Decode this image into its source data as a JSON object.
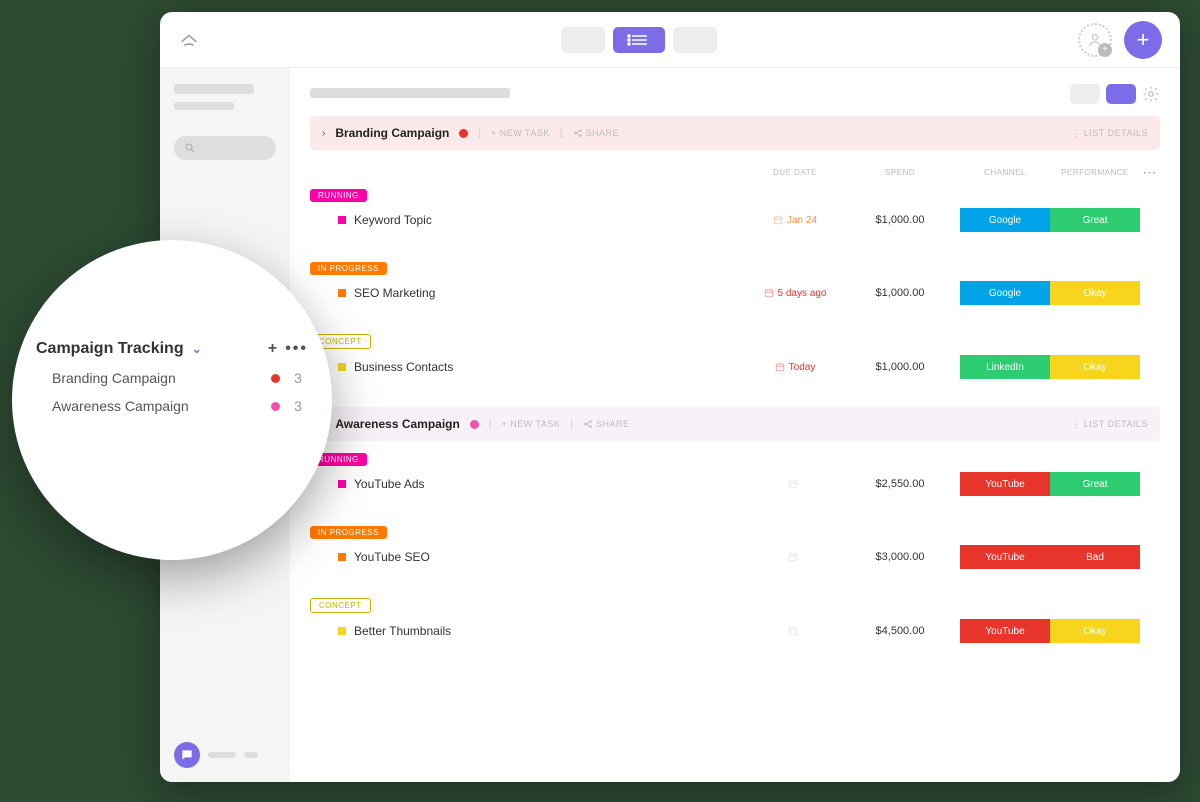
{
  "colors": {
    "accent": "#7C6CE8",
    "red": "#E7352C",
    "pink": "#F74FAF",
    "ff00a8": "#ff00a8",
    "orange": "#FF7A00",
    "yellowText": "#C9B200",
    "yellow": "#F7D51D",
    "green": "#2ECC71",
    "blue": "#00A3E8",
    "dateOrange": "#F58F4B",
    "dateRed": "#E7352C"
  },
  "header": {
    "newTask": "+ NEW TASK",
    "share": "SHARE",
    "listDetails": "LIST DETAILS"
  },
  "columns": {
    "dueDate": "DUE DATE",
    "spend": "SPEND",
    "channel": "CHANNEL",
    "performance": "PERFORMANCE"
  },
  "statuses": {
    "running": "RUNNING",
    "inProgress": "IN PROGRESS",
    "concept": "CONCEPT"
  },
  "campaigns": [
    {
      "title": "Branding Campaign",
      "dotColor": "#E7352C",
      "barClass": "",
      "groups": [
        {
          "status": "running",
          "statusColor": "#ff00a8",
          "rows": [
            {
              "sqColor": "#ff00a8",
              "name": "Keyword Topic",
              "date": "Jan 24",
              "dateColor": "#F58F4B",
              "spend": "$1,000.00",
              "channel": "Google",
              "channelColor": "#00A3E8",
              "perf": "Great",
              "perfColor": "#2ECC71"
            }
          ]
        },
        {
          "status": "inProgress",
          "statusColor": "#FF7A00",
          "rows": [
            {
              "sqColor": "#FF7A00",
              "name": "SEO Marketing",
              "date": "5 days ago",
              "dateColor": "#E7352C",
              "spend": "$1,000.00",
              "channel": "Google",
              "channelColor": "#00A3E8",
              "perf": "Okay",
              "perfColor": "#F7D51D"
            }
          ]
        },
        {
          "status": "concept",
          "statusColor": "#C9B200",
          "rows": [
            {
              "sqColor": "#F7D51D",
              "name": "Business Contacts",
              "date": "Today",
              "dateColor": "#E7352C",
              "spend": "$1,000.00",
              "channel": "LinkedIn",
              "channelColor": "#2ECC71",
              "perf": "Okay",
              "perfColor": "#F7D51D"
            }
          ]
        }
      ]
    },
    {
      "title": "Awareness Campaign",
      "dotColor": "#F74FAF",
      "barClass": "alt",
      "groups": [
        {
          "status": "running",
          "statusColor": "#ff00a8",
          "rows": [
            {
              "sqColor": "#ff00a8",
              "name": "YouTube Ads",
              "date": "",
              "dateColor": "#bbb",
              "spend": "$2,550.00",
              "channel": "YouTube",
              "channelColor": "#E7352C",
              "perf": "Great",
              "perfColor": "#2ECC71"
            }
          ]
        },
        {
          "status": "inProgress",
          "statusColor": "#FF7A00",
          "rows": [
            {
              "sqColor": "#FF7A00",
              "name": "YouTube SEO",
              "date": "",
              "dateColor": "#bbb",
              "spend": "$3,000.00",
              "channel": "YouTube",
              "channelColor": "#E7352C",
              "perf": "Bad",
              "perfColor": "#E7352C"
            }
          ]
        },
        {
          "status": "concept",
          "statusColor": "#C9B200",
          "rows": [
            {
              "sqColor": "#F7D51D",
              "name": "Better Thumbnails",
              "date": "",
              "dateColor": "#bbb",
              "spend": "$4,500.00",
              "channel": "YouTube",
              "channelColor": "#E7352C",
              "perf": "Okay",
              "perfColor": "#F7D51D"
            }
          ]
        }
      ]
    }
  ],
  "zoom": {
    "title": "Campaign Tracking",
    "items": [
      {
        "name": "Branding Campaign",
        "dotColor": "#E7352C",
        "count": "3"
      },
      {
        "name": "Awareness Campaign",
        "dotColor": "#F74FAF",
        "count": "3"
      }
    ]
  }
}
